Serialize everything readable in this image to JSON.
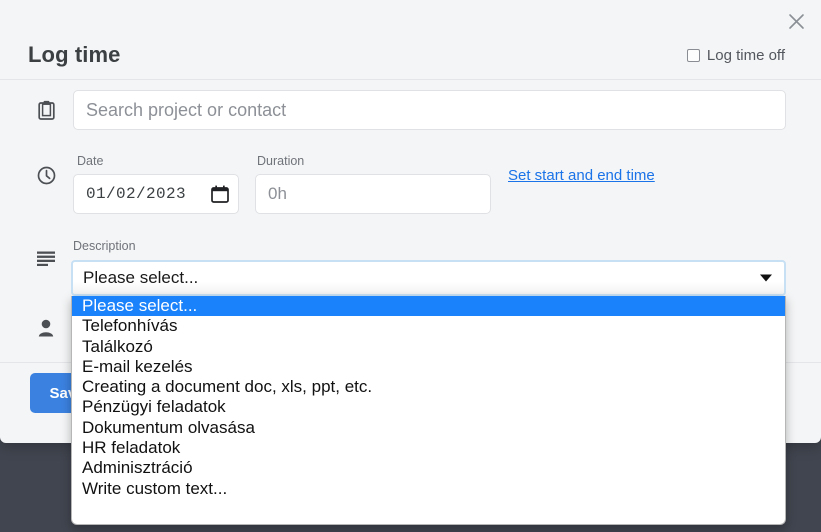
{
  "modal": {
    "title": "Log time",
    "close_icon": "close-icon",
    "log_time_off": {
      "label": "Log time off",
      "checked": false
    }
  },
  "search": {
    "icon": "clipboard-icon",
    "value": "",
    "placeholder": "Search project or contact"
  },
  "time": {
    "icon": "clock-icon",
    "date_label": "Date",
    "date_value": "01/02/2023",
    "calendar_icon": "calendar-icon",
    "duration_label": "Duration",
    "duration_value": "",
    "duration_placeholder": "0h",
    "set_time_link": "Set start and end time"
  },
  "description": {
    "icon": "description-lines-icon",
    "label": "Description",
    "selected_value": "Please select...",
    "arrow_icon": "chevron-down-icon",
    "options": [
      "Please select...",
      "Telefonhívás",
      "Találkozó",
      "E-mail kezelés",
      "Creating a document doc, xls, ppt, etc.",
      "Pénzügyi feladatok",
      "Dokumentum olvasása",
      "HR feladatok",
      "Adminisztráció",
      "Write custom text..."
    ],
    "selected_index": 0
  },
  "assignee": {
    "icon": "person-icon"
  },
  "footer": {
    "save_label": "Save"
  },
  "colors": {
    "accent_blue": "#3b82e0",
    "link_blue": "#1a73e8",
    "highlight_blue": "#1a82fb",
    "backdrop": "#41454f",
    "modal_bg": "#f4f5f6"
  }
}
